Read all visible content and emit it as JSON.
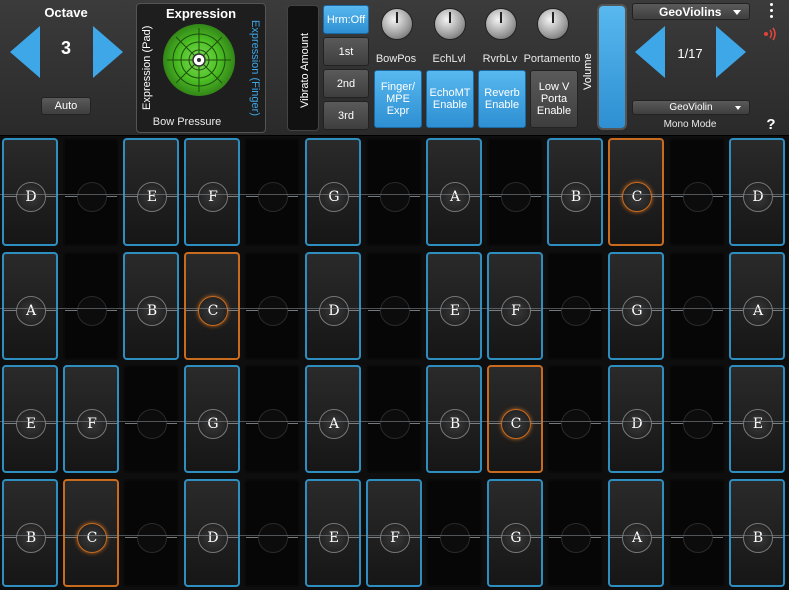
{
  "octave": {
    "title": "Octave",
    "value": "3",
    "auto_label": "Auto"
  },
  "expression": {
    "title": "Expression",
    "pad_label": "Expression (Pad)",
    "finger_label": "Expression (Finger)",
    "bottom_label": "Bow Pressure"
  },
  "vibrato": {
    "label": "Vibrato Amount"
  },
  "harmonics": {
    "buttons": [
      "Hrm:Off",
      "1st",
      "2nd",
      "3rd"
    ]
  },
  "knobs": [
    {
      "label": "BowPos"
    },
    {
      "label": "EchLvl"
    },
    {
      "label": "RvrbLv"
    },
    {
      "label": "Portamento"
    }
  ],
  "toggles": [
    {
      "label": "Finger/ MPE Expr",
      "on": true
    },
    {
      "label": "EchoMT Enable",
      "on": true
    },
    {
      "label": "Reverb Enable",
      "on": true
    },
    {
      "label": "Low V Porta Enable",
      "on": false
    }
  ],
  "volume": {
    "label": "Volume"
  },
  "preset": {
    "name": "GeoViolins",
    "position": "1/17",
    "sub": "GeoViolin",
    "mode": "Mono Mode"
  },
  "menu_icon": "vertical-dots-icon",
  "help_label": "?",
  "colors": {
    "accent": "#3ea7e8",
    "highlight": "#c86b1f",
    "wave": "#e0443a",
    "pad": "#4cc024"
  },
  "grid": {
    "rows": [
      {
        "cells": [
          {
            "note": "D",
            "style": "blue"
          },
          {
            "note": "",
            "style": "dark"
          },
          {
            "note": "E",
            "style": "blue"
          },
          {
            "note": "F",
            "style": "blue"
          },
          {
            "note": "",
            "style": "dark"
          },
          {
            "note": "G",
            "style": "blue"
          },
          {
            "note": "",
            "style": "dark"
          },
          {
            "note": "A",
            "style": "blue"
          },
          {
            "note": "",
            "style": "dark"
          },
          {
            "note": "B",
            "style": "blue"
          },
          {
            "note": "C",
            "style": "orange"
          },
          {
            "note": "",
            "style": "dark"
          },
          {
            "note": "D",
            "style": "blue"
          }
        ]
      },
      {
        "cells": [
          {
            "note": "A",
            "style": "blue"
          },
          {
            "note": "",
            "style": "dark"
          },
          {
            "note": "B",
            "style": "blue"
          },
          {
            "note": "C",
            "style": "orange"
          },
          {
            "note": "",
            "style": "dark"
          },
          {
            "note": "D",
            "style": "blue"
          },
          {
            "note": "",
            "style": "dark"
          },
          {
            "note": "E",
            "style": "blue"
          },
          {
            "note": "F",
            "style": "blue"
          },
          {
            "note": "",
            "style": "dark"
          },
          {
            "note": "G",
            "style": "blue"
          },
          {
            "note": "",
            "style": "dark"
          },
          {
            "note": "A",
            "style": "blue"
          }
        ]
      },
      {
        "cells": [
          {
            "note": "E",
            "style": "blue"
          },
          {
            "note": "F",
            "style": "blue"
          },
          {
            "note": "",
            "style": "dark"
          },
          {
            "note": "G",
            "style": "blue"
          },
          {
            "note": "",
            "style": "dark"
          },
          {
            "note": "A",
            "style": "blue"
          },
          {
            "note": "",
            "style": "dark"
          },
          {
            "note": "B",
            "style": "blue"
          },
          {
            "note": "C",
            "style": "orange"
          },
          {
            "note": "",
            "style": "dark"
          },
          {
            "note": "D",
            "style": "blue"
          },
          {
            "note": "",
            "style": "dark"
          },
          {
            "note": "E",
            "style": "blue"
          }
        ]
      },
      {
        "cells": [
          {
            "note": "B",
            "style": "blue"
          },
          {
            "note": "C",
            "style": "orange"
          },
          {
            "note": "",
            "style": "dark"
          },
          {
            "note": "D",
            "style": "blue"
          },
          {
            "note": "",
            "style": "dark"
          },
          {
            "note": "E",
            "style": "blue"
          },
          {
            "note": "F",
            "style": "blue"
          },
          {
            "note": "",
            "style": "dark"
          },
          {
            "note": "G",
            "style": "blue"
          },
          {
            "note": "",
            "style": "dark"
          },
          {
            "note": "A",
            "style": "blue"
          },
          {
            "note": "",
            "style": "dark"
          },
          {
            "note": "B",
            "style": "blue"
          }
        ]
      }
    ]
  }
}
